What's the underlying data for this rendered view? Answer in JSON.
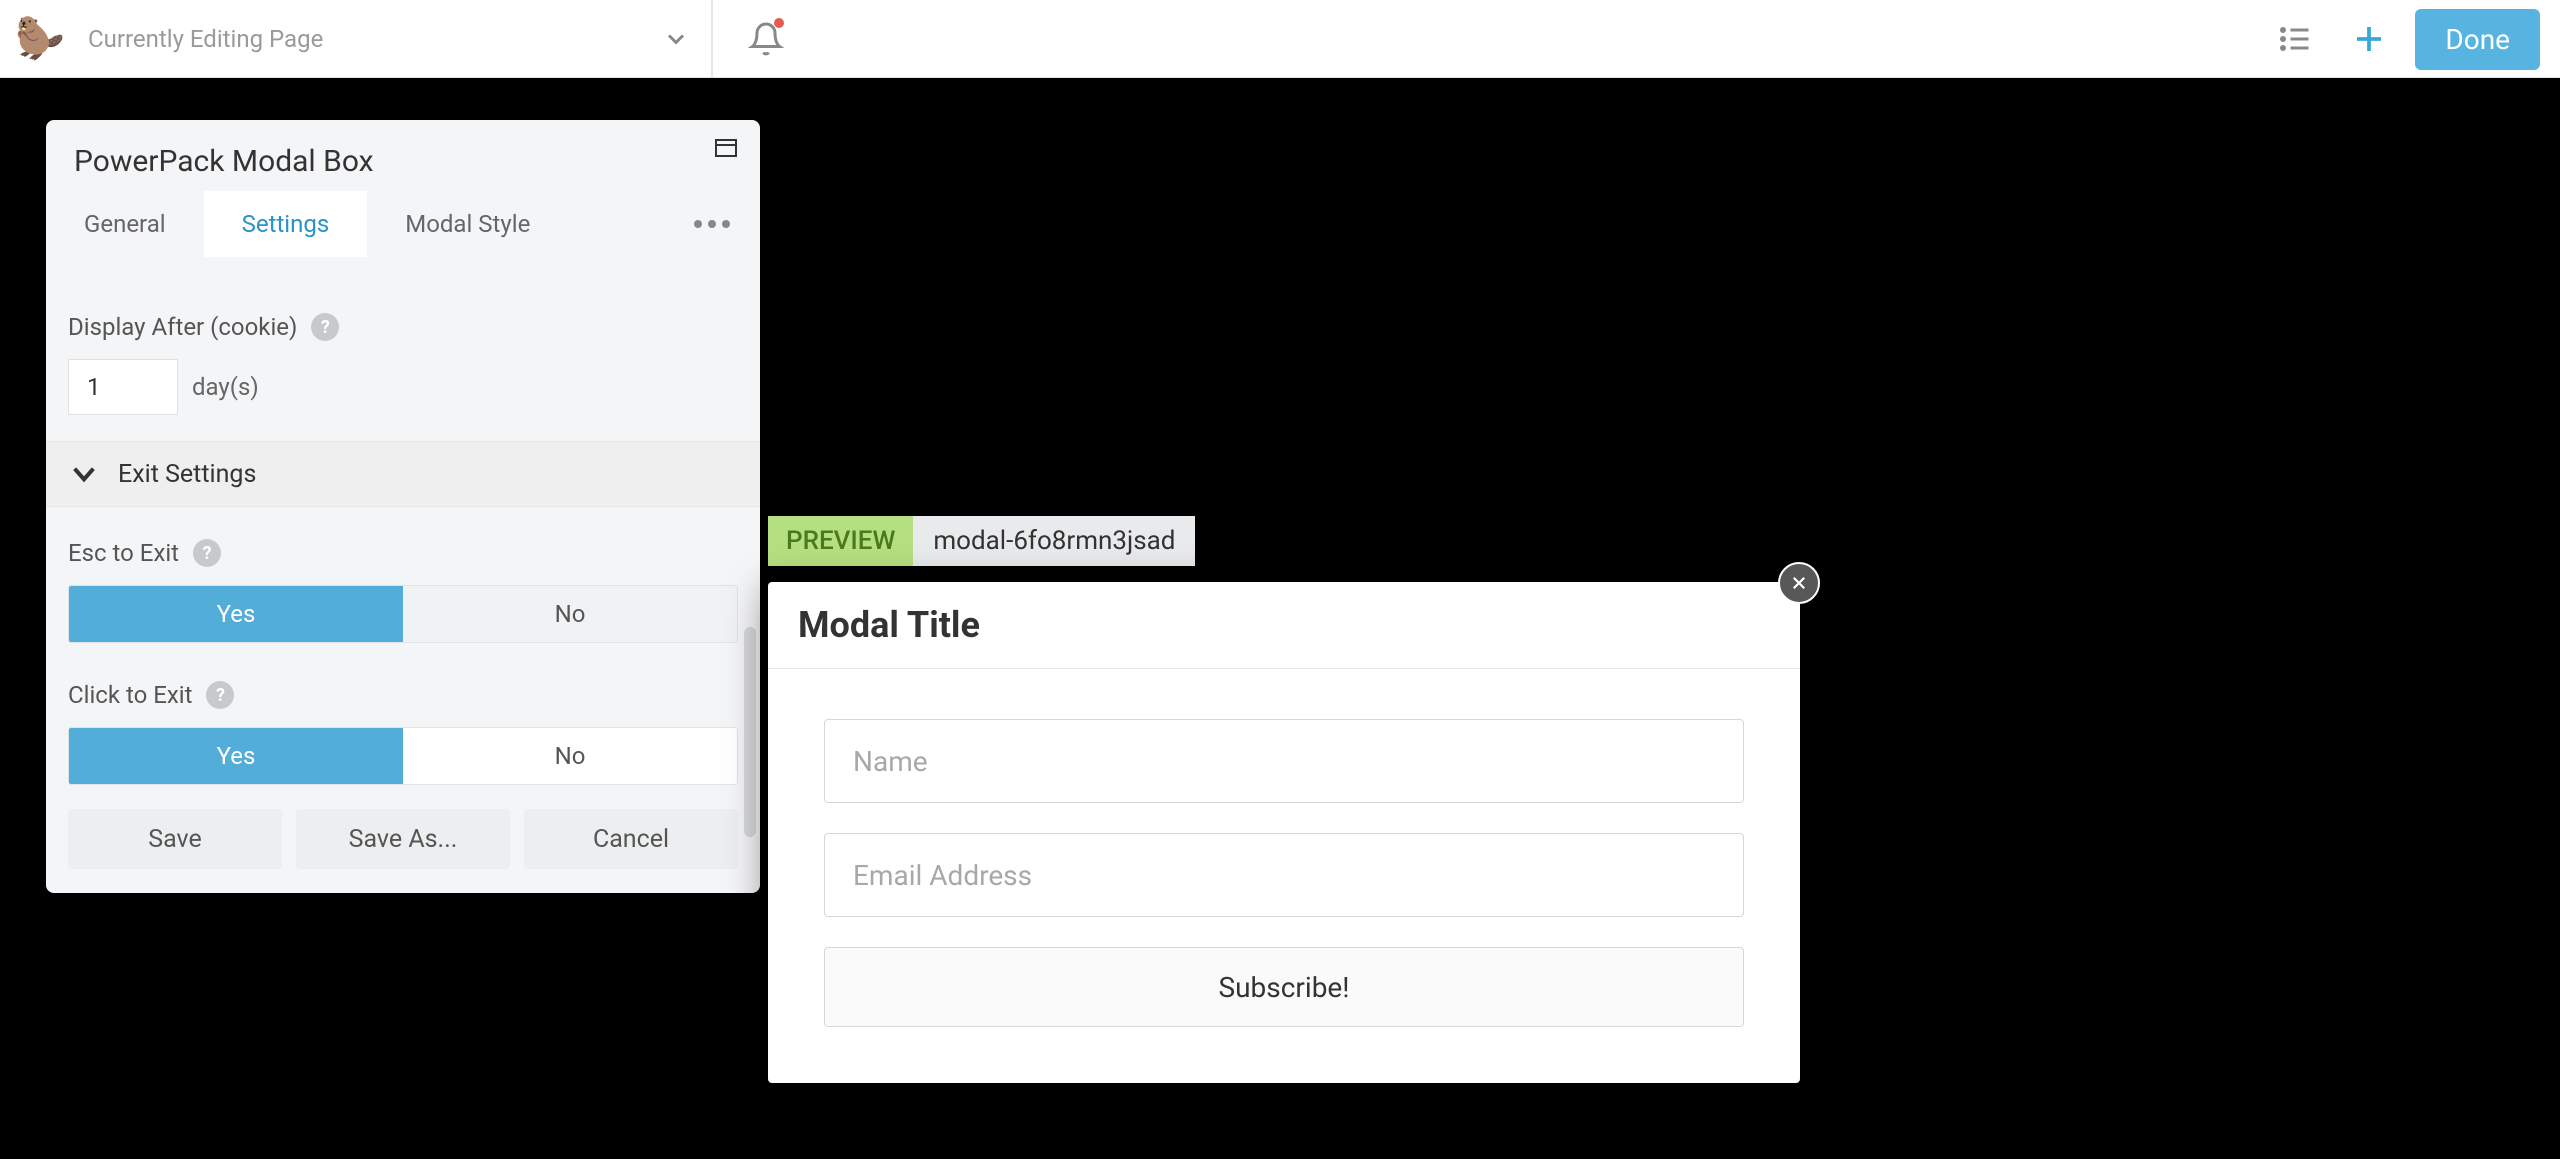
{
  "topbar": {
    "page_title": "Currently Editing Page",
    "done_label": "Done"
  },
  "panel": {
    "title": "PowerPack Modal Box",
    "tabs": {
      "general": "General",
      "settings": "Settings",
      "modal_style": "Modal Style"
    },
    "display_after": {
      "label": "Display After (cookie)",
      "value": "1",
      "unit": "day(s)"
    },
    "exit_section": {
      "title": "Exit Settings"
    },
    "esc_to_exit": {
      "label": "Esc to Exit",
      "yes": "Yes",
      "no": "No"
    },
    "click_to_exit": {
      "label": "Click to Exit",
      "yes": "Yes",
      "no": "No"
    },
    "footer": {
      "save": "Save",
      "save_as": "Save As...",
      "cancel": "Cancel"
    }
  },
  "preview": {
    "label": "PREVIEW",
    "id": "modal-6fo8rmn3jsad"
  },
  "modal": {
    "title": "Modal Title",
    "name_placeholder": "Name",
    "email_placeholder": "Email Address",
    "submit_label": "Subscribe!"
  }
}
